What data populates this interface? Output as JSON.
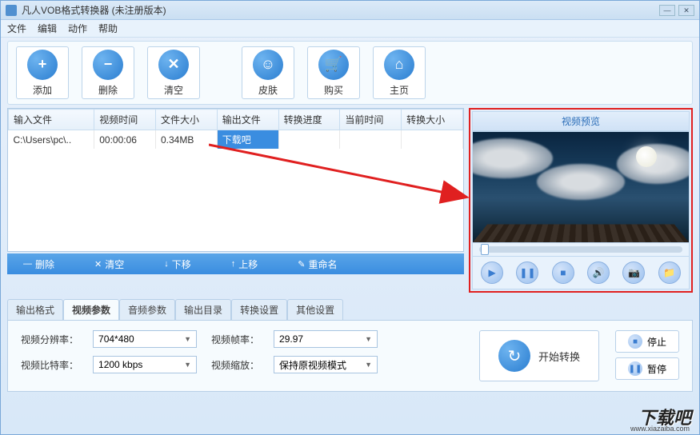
{
  "window": {
    "title": "凡人VOB格式转换器  (未注册版本)"
  },
  "menus": [
    "文件",
    "编辑",
    "动作",
    "帮助"
  ],
  "toolbar": [
    {
      "label": "添加",
      "icon": "+"
    },
    {
      "label": "删除",
      "icon": "−"
    },
    {
      "label": "清空",
      "icon": "✕"
    },
    {
      "label": "皮肤",
      "icon": "☺"
    },
    {
      "label": "购买",
      "icon": "🛒"
    },
    {
      "label": "主页",
      "icon": "⌂"
    }
  ],
  "table": {
    "headers": [
      "输入文件",
      "视频时间",
      "文件大小",
      "输出文件",
      "转换进度",
      "当前时间",
      "转换大小"
    ],
    "rows": [
      {
        "input": "C:\\Users\\pc\\..",
        "videotime": "00:00:06",
        "filesize": "0.34MB",
        "output": "下载吧",
        "progress": "",
        "curtime": "",
        "convsize": ""
      }
    ]
  },
  "listActions": [
    {
      "label": "删除",
      "icon": "—"
    },
    {
      "label": "清空",
      "icon": "✕"
    },
    {
      "label": "下移",
      "icon": "↓"
    },
    {
      "label": "上移",
      "icon": "↑"
    },
    {
      "label": "重命名",
      "icon": "✎"
    }
  ],
  "preview": {
    "title": "视频预览"
  },
  "tabs": [
    "输出格式",
    "视频参数",
    "音频参数",
    "输出目录",
    "转换设置",
    "其他设置"
  ],
  "activeTab": 1,
  "settings": {
    "resolution_label": "视频分辨率：",
    "resolution_value": "704*480",
    "framerate_label": "视频帧率：",
    "framerate_value": "29.97",
    "bitrate_label": "视频比特率：",
    "bitrate_value": "1200 kbps",
    "scale_label": "视频缩放：",
    "scale_value": "保持原视频模式"
  },
  "actions": {
    "start": "开始转换",
    "stop": "停止",
    "pause": "暂停"
  },
  "watermark": {
    "main": "下载吧",
    "sub": "www.xiazaiba.com"
  }
}
